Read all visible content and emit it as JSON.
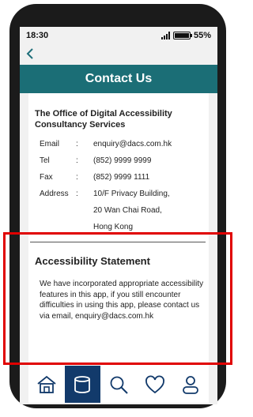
{
  "status_bar": {
    "time": "18:30",
    "battery": "55%"
  },
  "header": {
    "back_icon": "chevron-left-icon",
    "title": "Contact Us"
  },
  "organization": {
    "name": "The Office of Digital Accessibility Consultancy Services"
  },
  "contact": {
    "rows": [
      {
        "label": "Email",
        "sep": ":",
        "value": "enquiry@dacs.com.hk"
      },
      {
        "label": "Tel",
        "sep": ":",
        "value": "(852) 9999 9999"
      },
      {
        "label": "Fax",
        "sep": ":",
        "value": "(852) 9999 1111"
      },
      {
        "label": "Address",
        "sep": ":",
        "value": "10/F Privacy Building,"
      }
    ],
    "address_lines": [
      "20 Wan Chai Road,",
      "Hong Kong"
    ]
  },
  "accessibility": {
    "title": "Accessibility Statement",
    "body": "We have incorporated appropriate accessibility features in this app, if you still encounter difficulties in using this app, please contact us via email, enquiry@dacs.com.hk"
  },
  "bottom_nav": {
    "items": [
      {
        "icon": "home-icon",
        "active": false
      },
      {
        "icon": "database-icon",
        "active": true
      },
      {
        "icon": "search-icon",
        "active": false
      },
      {
        "icon": "heart-icon",
        "active": false
      },
      {
        "icon": "user-icon",
        "active": false
      }
    ]
  },
  "colors": {
    "header": "#1b6e76",
    "accent": "#123a6b",
    "highlight": "#e00000"
  }
}
